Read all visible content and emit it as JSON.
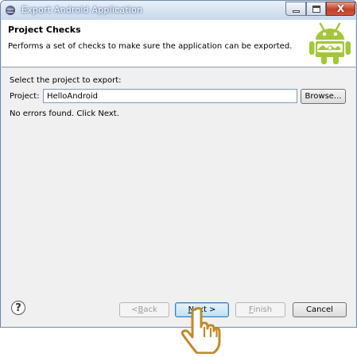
{
  "window": {
    "title": "Export Android Application",
    "close_glyph": "X"
  },
  "banner": {
    "title": "Project Checks",
    "description": "Performs a set of checks to make sure the application can be exported."
  },
  "content": {
    "select_label": "Select the project to export:",
    "project_label": "Project:",
    "project_value": "HelloAndroid",
    "browse_label": "Browse...",
    "status": "No errors found. Click Next."
  },
  "footer": {
    "help_glyph": "?",
    "back_prefix": "< ",
    "back_mnemonic": "B",
    "back_rest": "ack",
    "next_mnemonic": "N",
    "next_rest": "ext >",
    "finish_mnemonic": "F",
    "finish_rest": "inish",
    "cancel_label": "Cancel"
  },
  "colors": {
    "android_green": "#a4c639",
    "title_bar": "#c7d8ec",
    "dialog_bg": "#f0f0f0"
  },
  "icons": [
    "eclipse-icon",
    "android-robot-icon",
    "help-icon",
    "hand-cursor-icon"
  ]
}
